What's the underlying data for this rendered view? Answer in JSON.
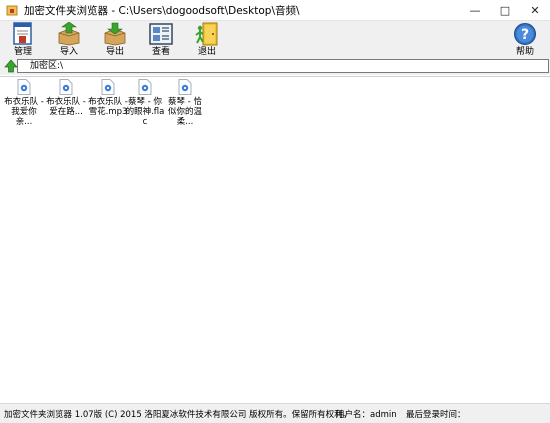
{
  "window": {
    "title": "加密文件夹浏览器 - C:\\Users\\dogoodsoft\\Desktop\\音频\\",
    "controls": {
      "minimize": "—",
      "maximize": "□",
      "close": "✕"
    }
  },
  "toolbar": {
    "items": [
      {
        "label": "管理",
        "icon": "manage-icon"
      },
      {
        "label": "导入",
        "icon": "import-box-icon"
      },
      {
        "label": "导出",
        "icon": "export-box-icon"
      },
      {
        "label": "查看",
        "icon": "view-icon"
      },
      {
        "label": "退出",
        "icon": "exit-door-icon"
      },
      {
        "label": "帮助",
        "icon": "help-icon"
      }
    ]
  },
  "address": {
    "up_icon": "up-arrow-icon",
    "path": "加密区:\\"
  },
  "files": [
    {
      "name": "布衣乐队 - 我爱你亲..."
    },
    {
      "name": "布衣乐队 - 爱在路..."
    },
    {
      "name": "布衣乐队 - 雪花.mp3"
    },
    {
      "name": "蔡琴 - 你的眼神.flac"
    },
    {
      "name": "蔡琴 - 恰似你的温柔..."
    }
  ],
  "status": {
    "copyright": "加密文件夹浏览器 1.07版 (C) 2015 洛阳夏冰软件技术有限公司 版权所有。保留所有权利。",
    "user": "用户名：admin",
    "last_login": "最后登录时间："
  },
  "colors": {
    "toolbar_bg": "#f0f0f0",
    "accent_green": "#3aa52e",
    "help_blue": "#2f6fc1"
  }
}
